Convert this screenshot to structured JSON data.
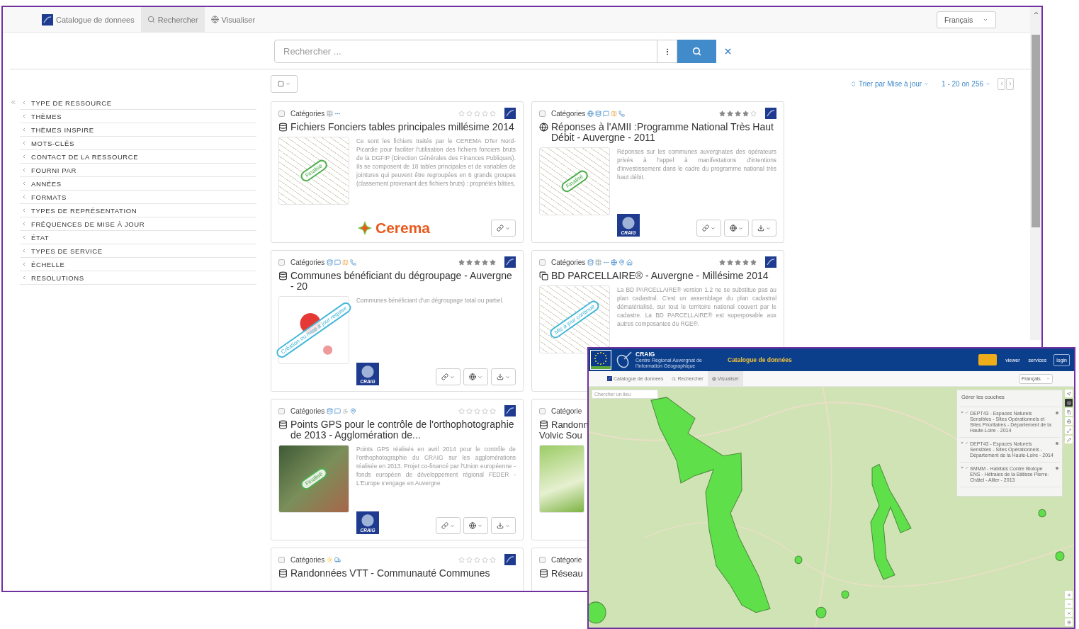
{
  "main_window": {
    "navbar": {
      "items": [
        {
          "kind": "brand",
          "label": "Catalogue de donnees",
          "selected": false
        },
        {
          "kind": "search",
          "label": "Rechercher",
          "selected": true
        },
        {
          "kind": "globe",
          "label": "Visualiser",
          "selected": false
        }
      ],
      "language": "Français"
    },
    "search": {
      "placeholder": "Rechercher ..."
    },
    "sidebar": {
      "items": [
        "TYPE DE RESSOURCE",
        "THÈMES",
        "THÈMES INSPIRE",
        "MOTS-CLÉS",
        "CONTACT DE LA RESSOURCE",
        "FOURNI PAR",
        "ANNÉES",
        "FORMATS",
        "TYPES DE REPRÉSENTATION",
        "FRÉQUENCES DE MISE À JOUR",
        "ÉTAT",
        "TYPES DE SERVICE",
        "ÉCHELLE",
        "RESOLUTIONS"
      ]
    },
    "toolbar": {
      "sort": "Trier par Mise à jour",
      "paging": "1 - 20 on 256"
    },
    "cards": [
      {
        "kind": "full",
        "checked": false,
        "category_label": "Catégories",
        "category_icons": [
          {
            "kind": "table"
          },
          {
            "kind": "more"
          }
        ],
        "stars": 0,
        "title_icon": {
          "kind": "database"
        },
        "title": "Fichiers Fonciers tables principales millésime 2014",
        "thumbnail": {
          "kind": "map"
        },
        "badge": {
          "label": "Finalisé",
          "color": "#4cae4c"
        },
        "description": "Ce sont les fichiers traités par le CEREMA DTer Nord-Picardie pour faciliter l'utilisation des fichiers fonciers bruts de la DGFIP (Direction Générales des Finances Publiques). Ils se composent de 18 tables principales et de variables de jointures qui peuvent être regroupées en 6 grands groupes (classement provenant des fichiers bruts) : propriétés bâties,",
        "logo": {
          "kind": "cerema",
          "label": "Cerema"
        },
        "buttons": [
          {
            "kind": "link"
          }
        ]
      },
      {
        "kind": "full",
        "checked": false,
        "category_label": "Catégories",
        "category_icons": [
          {
            "kind": "globe"
          },
          {
            "kind": "database"
          },
          {
            "kind": "chat"
          },
          {
            "kind": "map"
          },
          {
            "kind": "phone"
          }
        ],
        "stars": 4,
        "title_icon": {
          "kind": "globe"
        },
        "title": "Réponses à l'AMII :Programme National Très Haut Débit - Auvergne - 2011",
        "thumbnail": {
          "kind": "map"
        },
        "badge": {
          "label": "Finalisé",
          "color": "#4cae4c"
        },
        "description": "Réponses sur les communes auvergnates des opérateurs privés à l'appel à manifestations d'intentions d'investissement dans le cadre du programme national très haut débit.",
        "logo": {
          "kind": "craig",
          "label": "CRAIG"
        },
        "buttons": [
          {
            "kind": "link"
          },
          {
            "kind": "globe"
          },
          {
            "kind": "download"
          }
        ]
      },
      {
        "kind": "full",
        "checked": false,
        "category_label": "Catégories",
        "category_icons": [
          {
            "kind": "database"
          },
          {
            "kind": "chat"
          },
          {
            "kind": "map"
          },
          {
            "kind": "phone"
          }
        ],
        "stars": 5,
        "title_icon": {
          "kind": "database"
        },
        "title": "Communes bénéficiant du dégroupage - Auvergne - 20",
        "thumbnail": {
          "kind": "dots"
        },
        "badge": {
          "label": "Création ou mise à jour requise",
          "color": "#46b8da"
        },
        "description": "Communes bénéficiant d'un dégroupage total ou partiel.",
        "logo": {
          "kind": "craig",
          "label": "CRAIG"
        },
        "buttons": [
          {
            "kind": "link"
          },
          {
            "kind": "globe"
          },
          {
            "kind": "download"
          }
        ]
      },
      {
        "kind": "full",
        "checked": false,
        "category_label": "Catégories",
        "category_icons": [
          {
            "kind": "database"
          },
          {
            "kind": "table"
          },
          {
            "kind": "more"
          },
          {
            "kind": "globe"
          },
          {
            "kind": "pin"
          },
          {
            "kind": "home"
          }
        ],
        "stars": 5,
        "title_icon": {
          "kind": "copy"
        },
        "title": "BD PARCELLAIRE® - Auvergne - Millésime 2014",
        "thumbnail": {
          "kind": "map"
        },
        "badge": {
          "label": "Mis à jour continue",
          "color": "#46b8da"
        },
        "description": "La BD PARCELLAIRE® version 1.2 ne se substitue pas au plan cadastral. C'est un assemblage du plan cadastral dématérialisé, sur tout le territoire national couvert par le cadastre. La BD PARCELLAIRE® est superposable aux autres composantes du RGE®."
      },
      {
        "kind": "full",
        "checked": false,
        "category_label": "Catégories",
        "category_icons": [
          {
            "kind": "database"
          },
          {
            "kind": "chat"
          },
          {
            "kind": "wheelchair"
          },
          {
            "kind": "pin"
          }
        ],
        "stars": 0,
        "title_icon": {
          "kind": "database"
        },
        "title": "Points GPS pour le contrôle de l'orthophotographie de 2013 - Agglomération de...",
        "thumbnail": {
          "kind": "photo"
        },
        "badge": {
          "label": "Finalisé",
          "color": "#4cae4c"
        },
        "description": "Points GPS réalisés en avril 2014 pour le contrôle de l'orthophotographie du CRAIG sur les agglomérations réalisée en 2013. Projet co-financé par l'Union européenne - fonds européen de développement régional FEDER - L'Europe s'engage en Auvergne",
        "logo": {
          "kind": "craig",
          "label": "CRAIG"
        },
        "buttons": [
          {
            "kind": "link"
          },
          {
            "kind": "globe"
          },
          {
            "kind": "download"
          }
        ]
      },
      {
        "kind": "clipped",
        "checked": false,
        "category_label": "Catégorie",
        "title_icon": {
          "kind": "database"
        },
        "title_lines": [
          "Randonn",
          "Volvic Sou"
        ],
        "thumbnail": {
          "kind": "green"
        }
      },
      {
        "kind": "header",
        "checked": false,
        "category_label": "Catégories",
        "category_icons": [
          {
            "kind": "sun"
          },
          {
            "kind": "truck"
          }
        ],
        "stars": 0,
        "title_icon": {
          "kind": "database"
        },
        "title": "Randonnées VTT - Communauté Communes"
      },
      {
        "kind": "clipped",
        "checked": false,
        "category_label": "Catégorie",
        "title_icon": {
          "kind": "database"
        },
        "title_lines": [
          "Réseau"
        ]
      }
    ]
  },
  "overlay_window": {
    "header": {
      "brand": "CRAIG",
      "subtitle": "Centre Régional Auvergnat de l'Information Géographique",
      "title": "Catalogue de données",
      "links": [
        "viewer",
        "services"
      ],
      "login": "login"
    },
    "navbar": {
      "items": [
        {
          "kind": "brand",
          "label": "Catalogue de donnees",
          "selected": false
        },
        {
          "kind": "search",
          "label": "Rechercher",
          "selected": false
        },
        {
          "kind": "globe",
          "label": "Visualiser",
          "selected": true
        }
      ],
      "language": "Français"
    },
    "map": {
      "search_placeholder": "Chercher un lieu",
      "layer_panel": {
        "title": "Gérer les couches",
        "layers": [
          {
            "label": "DEPT43 - Espaces Naturels Sensibles - Sites Opérationnels et Sites Prioritaires - Département de la Haute-Loire - 2014",
            "checked": true
          },
          {
            "label": "DEPT43 - Espaces Naturels Sensibles - Sites Opérationnels - Département de la Haute-Loire - 2014",
            "checked": true
          },
          {
            "label": "SMMM - Habitats Contre Biotope ENS - Hêtraies de la Bâtisse Pierre-Châtel - Allier - 2013",
            "checked": true
          }
        ]
      }
    }
  }
}
